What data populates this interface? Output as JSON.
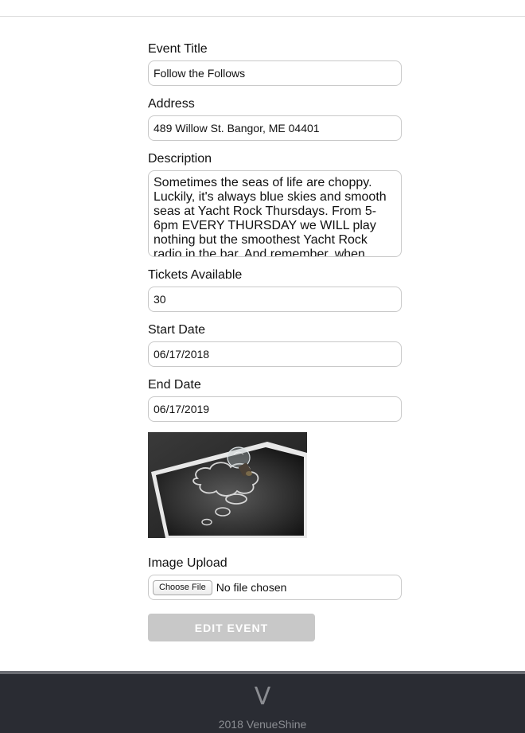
{
  "form": {
    "title_label": "Event Title",
    "title_value": "Follow the Follows",
    "address_label": "Address",
    "address_value": "489 Willow St. Bangor, ME 04401",
    "description_label": "Description",
    "description_value": "Sometimes the seas of life are choppy. Luckily, it's always blue skies and smooth seas at Yacht Rock Thursdays. From 5-6pm EVERY THURSDAY we WILL play nothing but the smoothest Yacht Rock radio in the bar. And remember, when",
    "tickets_label": "Tickets Available",
    "tickets_value": "30",
    "start_label": "Start Date",
    "start_value": "06/17/2018",
    "end_label": "End Date",
    "end_value": "06/17/2019",
    "image_upload_label": "Image Upload",
    "choose_file_label": "Choose File",
    "file_status": "No file chosen",
    "submit_label": "EDIT EVENT"
  },
  "footer": {
    "logo": "V",
    "copyright": "2018 VenueShine"
  },
  "colors": {
    "footer_bg": "#2a2c33",
    "submit_disabled": "#c8c8c8",
    "input_border": "#c9c9c9"
  }
}
